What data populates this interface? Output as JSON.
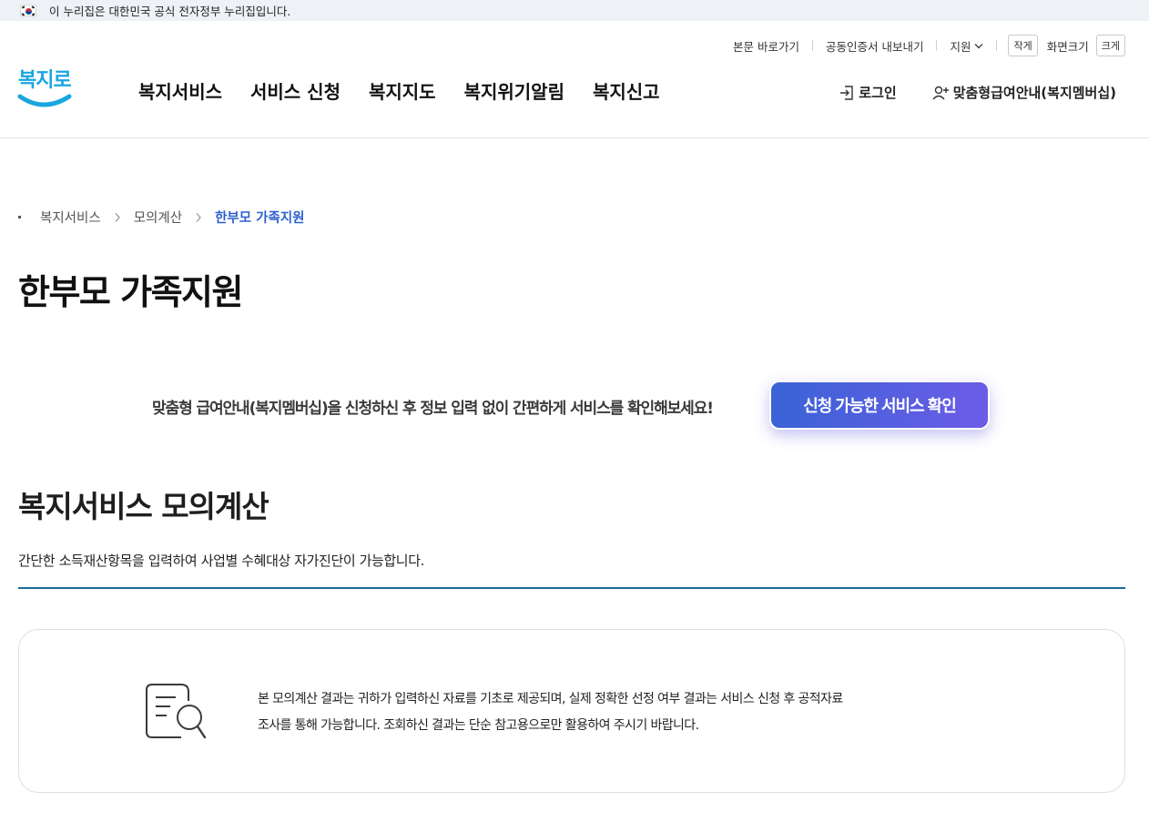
{
  "gov_banner": {
    "text": "이 누리집은 대한민국 공식 전자정부 누리집입니다."
  },
  "utility": {
    "skip_link": "본문 바로가기",
    "certificate": "공동인증서 내보내기",
    "support": "지원",
    "font_small": "작게",
    "font_size_label": "화면크기",
    "font_large": "크게"
  },
  "logo": {
    "text": "복지로"
  },
  "gnb": [
    "복지서비스",
    "서비스 신청",
    "복지지도",
    "복지위기알림",
    "복지신고"
  ],
  "account": {
    "login": "로그인",
    "membership": "맞춤형급여안내(복지멤버십)"
  },
  "breadcrumb": [
    "복지서비스",
    "모의계산",
    "한부모 가족지원"
  ],
  "page_title": "한부모 가족지원",
  "cta": {
    "text": "맞춤형 급여안내(복지멤버십)을 신청하신 후 정보 입력 없이 간편하게 서비스를 확인해보세요!",
    "button": "신청 가능한 서비스 확인"
  },
  "section": {
    "title": "복지서비스 모의계산",
    "description": "간단한 소득재산항목을 입력하여 사업별 수혜대상 자가진단이 가능합니다."
  },
  "notice": {
    "line1": "본 모의계산 결과는 귀하가 입력하신 자료를 기초로 제공되며, 실제 정확한 선정 여부 결과는 서비스 신청 후 공적자료",
    "line2": "조사를 통해 가능합니다. 조회하신 결과는 단순 참고용으로만 활용하여 주시기 바랍니다."
  },
  "colors": {
    "accent_blue": "#2c5fcf",
    "cta_gradient_start": "#3a63d6",
    "cta_gradient_end": "#6c5ce7",
    "section_line": "#1a6e9a",
    "logo_blue": "#1aa6e0"
  }
}
